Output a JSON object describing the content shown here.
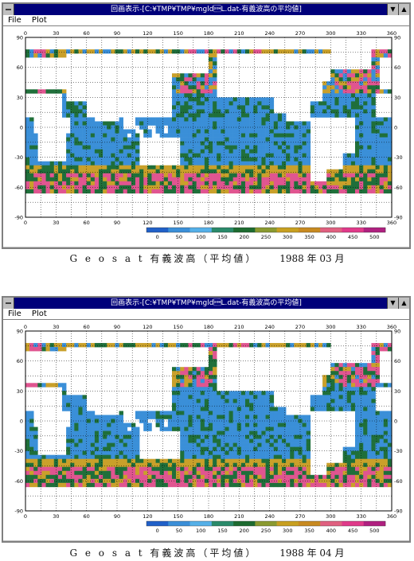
{
  "windows": [
    {
      "title": "回画表示-[C:¥TMP¥TMP¥mgld\u0001L.dat-有義波高の平均値]",
      "menu": [
        "File",
        "Plot"
      ],
      "caption_title": "G e o s a t 有義波高（平均値）",
      "caption_date": "1988 年 03 月",
      "month": "03"
    },
    {
      "title": "回画表示-[C:¥TMP¥TMP¥mgld\u0001L.dat-有義波高の平均値]",
      "menu": [
        "File",
        "Plot"
      ],
      "caption_title": "G e o s a t 有義波高（平均値）",
      "caption_date": "1988 年 04 月",
      "month": "04"
    }
  ],
  "axes": {
    "x_ticks": [
      "0",
      "30",
      "60",
      "90",
      "120",
      "150",
      "180",
      "210",
      "240",
      "270",
      "300",
      "330",
      "360"
    ],
    "y_ticks": [
      "90",
      "60",
      "30",
      "0",
      "-30",
      "-60",
      "-90"
    ],
    "x_range": [
      0,
      360
    ],
    "y_range": [
      -90,
      90
    ]
  },
  "colorbar": {
    "labels": [
      "0",
      "50",
      "100",
      "150",
      "200",
      "250",
      "300",
      "350",
      "400",
      "450",
      "500"
    ],
    "colors": [
      "#2060c8",
      "#3b8fd8",
      "#55b0e8",
      "#2a8a6a",
      "#1d6b30",
      "#8a9a30",
      "#c8a020",
      "#c88a20",
      "#e06080",
      "#e03a8a",
      "#b02080"
    ]
  },
  "palette": {
    "calm": "#3a8fd8",
    "mid": "#1f6f3a",
    "high": "#c9a02a",
    "very_high": "#e05590",
    "land": "#ffffff"
  }
}
